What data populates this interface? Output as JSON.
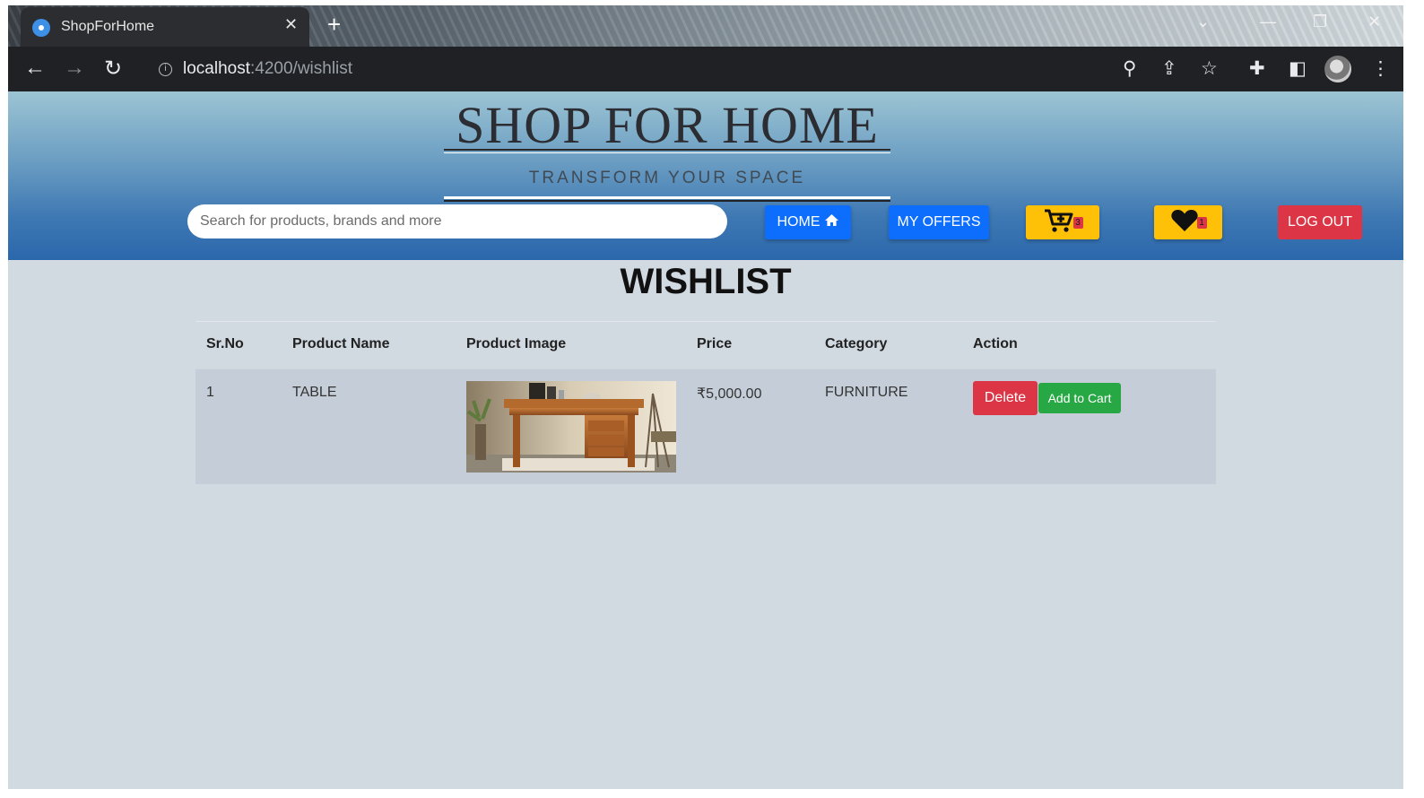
{
  "browser": {
    "tab_title": "ShopForHome",
    "url_host": "localhost",
    "url_rest": ":4200/wishlist"
  },
  "header": {
    "brand": "SHOP FOR HOME",
    "tagline": "TRANSFORM YOUR SPACE",
    "search_placeholder": "Search for products, brands and more",
    "home_label": "HOME",
    "offers_label": "MY OFFERS",
    "cart_count": "3",
    "wishlist_count": "1",
    "logout_label": "LOG OUT"
  },
  "page": {
    "title": "WISHLIST"
  },
  "table": {
    "headers": [
      "Sr.No",
      "Product Name",
      "Product Image",
      "Price",
      "Category",
      "Action"
    ],
    "rows": [
      {
        "sr_no": "1",
        "product_name": "TABLE",
        "price": "₹5,000.00",
        "category": "FURNITURE",
        "delete_label": "Delete",
        "add_label": "Add to Cart"
      }
    ]
  },
  "colors": {
    "primary": "#0d6efd",
    "danger": "#dc3545",
    "warning": "#ffc107",
    "success": "#28a745"
  },
  "icons": [
    "home-icon",
    "cart-plus-icon",
    "heart-icon",
    "info-icon",
    "zoom-icon",
    "share-icon",
    "star-icon",
    "extensions-icon",
    "side-panel-icon",
    "menu-icon"
  ]
}
